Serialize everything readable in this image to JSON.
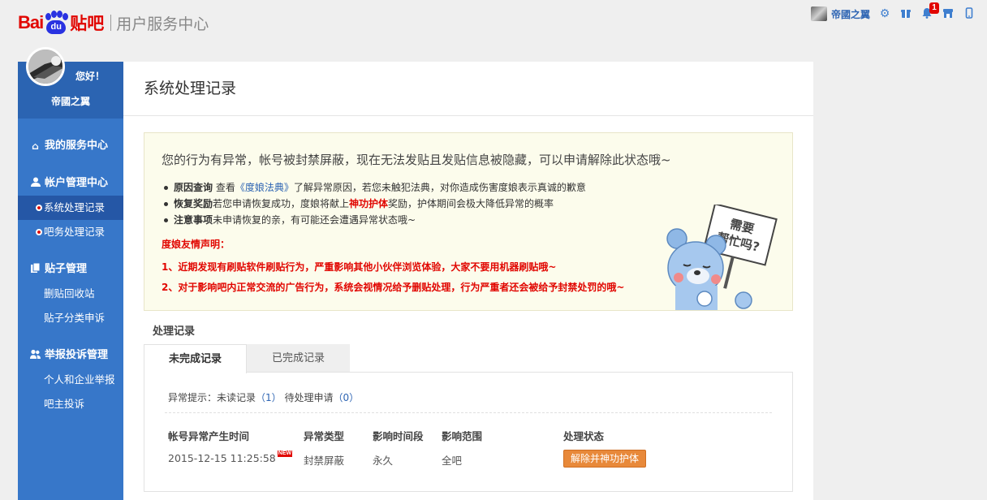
{
  "header": {
    "logo_bai": "Bai",
    "logo_du": "du",
    "logo_tieba": "贴吧",
    "center_name": "用户服务中心",
    "username": "帝國之翼",
    "notification_count": "1"
  },
  "sidebar": {
    "greeting": "您好！",
    "username": "帝國之翼",
    "sections": [
      {
        "label": "我的服务中心",
        "icon": "home-icon"
      },
      {
        "label": "帐户管理中心",
        "icon": "user-icon"
      },
      {
        "label": "贴子管理",
        "icon": "document-icon"
      },
      {
        "label": "举报投诉管理",
        "icon": "users-icon"
      }
    ],
    "items": {
      "system_records": "系统处理记录",
      "bar_records": "吧务处理记录",
      "recycle_bin": "删贴回收站",
      "post_category_appeal": "贴子分类申诉",
      "personal_report": "个人和企业举报",
      "owner_complaint": "吧主投诉"
    }
  },
  "main": {
    "title": "系统处理记录",
    "notice": {
      "headline": "您的行为有异常，帐号被封禁屏蔽，现在无法发贴且发贴信息被隐藏，可以申请解除此状态哦~",
      "b1_label": "原因查询",
      "b1_pre": "查看",
      "b1_link": "《度娘法典》",
      "b1_post": "了解异常原因，若您未触犯法典，对你造成伤害度娘表示真诚的歉意",
      "b2_label": "恢复奖励",
      "b2_pre": "若您申请恢复成功，度娘将献上",
      "b2_red": "神功护体",
      "b2_post": "奖励，护体期间会极大降低异常的概率",
      "b3_label": "注意事项",
      "b3_text": "未申请恢复的亲，有可能还会遭遇异常状态哦~",
      "statement_title": "度娘友情声明：",
      "statement_1": "1、近期发现有刷贴软件刷贴行为，严重影响其他小伙伴浏览体验，大家不要用机器刷贴哦~",
      "statement_2": "2、对于影响吧内正常交流的广告行为，系统会视情况给予删贴处理，行为严重者还会被给予封禁处罚的哦~",
      "bear_sign": "需要帮忙吗?",
      "bear_sign_line1": "需要",
      "bear_sign_line2": "帮忙吗?"
    },
    "records_title": "处理记录",
    "tabs": {
      "incomplete": "未完成记录",
      "complete": "已完成记录"
    },
    "hint": {
      "prefix": "异常提示：",
      "unread_label": "未读记录",
      "unread_count": "（1）",
      "pending_label": "待处理申请",
      "pending_count": "（0）"
    },
    "table": {
      "headers": {
        "time": "帐号异常产生时间",
        "type": "异常类型",
        "period": "影响时间段",
        "scope": "影响范围",
        "status": "处理状态"
      },
      "row": {
        "time": "2015-12-15 11:25:58",
        "new_tag": "NEW",
        "type": "封禁屏蔽",
        "period": "永久",
        "scope": "全吧",
        "action": "解除并神功护体"
      }
    }
  }
}
